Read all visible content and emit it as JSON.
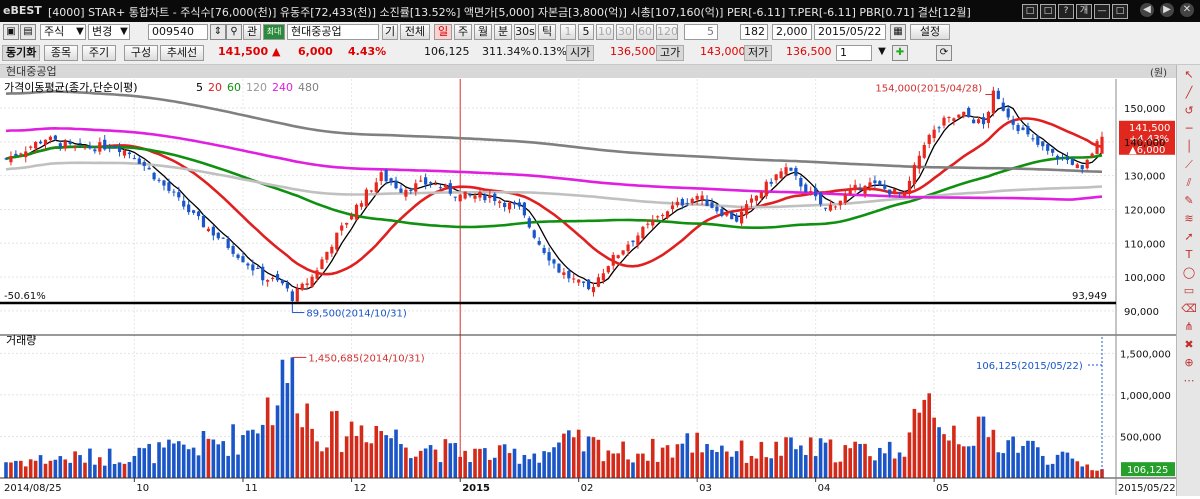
{
  "window": {
    "logo": "eBEST",
    "title": "[4000] STAR+ 통합차트 - 주식수[76,000(천)] 유동주[72,433(천)] 소진률[13.52%] 액면가[5,000] 자본금[3,800(억)] 시총[107,160(억)] PER[-6.11] T.PER[-6.11] PBR[0.71] 결산[12월]",
    "buttons": [
      "□",
      "□",
      "?",
      "개",
      "—",
      "□"
    ],
    "right_buttons": [
      "◀",
      "▶",
      "✕"
    ]
  },
  "toolbar1": {
    "market": "주식",
    "mode": "변경",
    "code": "009540",
    "relation": "관",
    "badge": "최대",
    "name": "현대중공업",
    "gi": "기",
    "jeonche": "전체",
    "periods": [
      "일",
      "주",
      "월",
      "분",
      "30s",
      "틱"
    ],
    "period_selected": "일",
    "numbers": [
      "1",
      "5",
      "10",
      "30",
      "60",
      "120"
    ],
    "number_sel": "5",
    "count": "182",
    "zoom": "2,000",
    "date": "2015/05/22",
    "settings": "설정"
  },
  "toolbar2": {
    "sync": "동기화",
    "buttons": [
      "종목",
      "주기",
      "구성",
      "추세선"
    ],
    "price": "141,500",
    "change": "6,000",
    "change_pct": "4.43%",
    "volume": "106,125",
    "vol_ratio": "311.34%",
    "turnover": "0.13%",
    "open_label": "시가",
    "open": "136,500",
    "high_label": "고가",
    "high": "143,000",
    "low_label": "저가",
    "low": "136,500",
    "sel": "1"
  },
  "chart": {
    "stock_name": "현대중공업",
    "unit": "(원)",
    "ma_label": "가격이동평균(종가,단순이평)",
    "ma_periods": [
      "5",
      "20",
      "60",
      "120",
      "240",
      "480"
    ],
    "ma_colors": [
      "#000000",
      "#e02020",
      "#109010",
      "#c0c0c0",
      "#e020e0",
      "#808080"
    ],
    "high_annotation": "154,000(2015/04/28)",
    "low_annotation": "89,500(2014/10/31)",
    "left_pct": "-50.61%",
    "right_value": "93,949",
    "price_tag": [
      "141,500",
      "+4.43%",
      "▲6,000"
    ],
    "volume_label": "거래량",
    "vol_max_annotation": "1,450,685(2014/10/31)",
    "vol_last_annotation": "106,125(2015/05/22)",
    "vol_tag": "106,125",
    "x_start": "2014/08/25",
    "x_end": "2015/05/22",
    "months": [
      "10",
      "11",
      "12",
      "2015",
      "02",
      "03",
      "04",
      "05"
    ]
  },
  "chart_data": {
    "type": "candlestick",
    "price_axis": {
      "ticks": [
        "150,000",
        "140,000",
        "130,000",
        "120,000",
        "110,000",
        "100,000",
        "90,000"
      ],
      "range": [
        87000,
        158000
      ]
    },
    "volume_axis": {
      "ticks": [
        "1,500,000",
        "1,000,000",
        "500,000"
      ],
      "range": [
        0,
        1600000
      ]
    },
    "close_keypoints": [
      [
        0,
        135000
      ],
      [
        8,
        141000
      ],
      [
        14,
        138000
      ],
      [
        22,
        139000
      ],
      [
        26,
        136000
      ],
      [
        32,
        127000
      ],
      [
        38,
        118000
      ],
      [
        46,
        108000
      ],
      [
        52,
        100000
      ],
      [
        56,
        98000
      ],
      [
        58,
        94000
      ],
      [
        62,
        100000
      ],
      [
        66,
        110000
      ],
      [
        72,
        123000
      ],
      [
        76,
        130000
      ],
      [
        80,
        126000
      ],
      [
        86,
        128000
      ],
      [
        92,
        124000
      ],
      [
        98,
        124000
      ],
      [
        104,
        120000
      ],
      [
        108,
        110000
      ],
      [
        112,
        102000
      ],
      [
        116,
        98000
      ],
      [
        118,
        96000
      ],
      [
        122,
        104000
      ],
      [
        126,
        110000
      ],
      [
        130,
        115000
      ],
      [
        134,
        120000
      ],
      [
        140,
        124000
      ],
      [
        144,
        120000
      ],
      [
        148,
        117000
      ],
      [
        152,
        124000
      ],
      [
        156,
        130000
      ],
      [
        158,
        132000
      ],
      [
        162,
        126000
      ],
      [
        166,
        120000
      ],
      [
        170,
        124000
      ],
      [
        174,
        128000
      ],
      [
        178,
        126000
      ],
      [
        182,
        124000
      ],
      [
        186,
        140000
      ],
      [
        190,
        146000
      ],
      [
        194,
        148000
      ],
      [
        198,
        145000
      ],
      [
        200,
        154000
      ],
      [
        204,
        146000
      ],
      [
        208,
        140000
      ],
      [
        212,
        136000
      ],
      [
        216,
        134000
      ],
      [
        218,
        131000
      ],
      [
        220,
        137000
      ],
      [
        222,
        141500
      ]
    ],
    "volume_keypoints": [
      [
        0,
        200000
      ],
      [
        20,
        260000
      ],
      [
        34,
        330000
      ],
      [
        40,
        400000
      ],
      [
        48,
        500000
      ],
      [
        56,
        1100000
      ],
      [
        58,
        1450685
      ],
      [
        62,
        600000
      ],
      [
        68,
        550000
      ],
      [
        74,
        650000
      ],
      [
        80,
        450000
      ],
      [
        90,
        320000
      ],
      [
        100,
        280000
      ],
      [
        108,
        300000
      ],
      [
        114,
        420000
      ],
      [
        120,
        380000
      ],
      [
        126,
        300000
      ],
      [
        134,
        350000
      ],
      [
        140,
        450000
      ],
      [
        150,
        300000
      ],
      [
        160,
        360000
      ],
      [
        170,
        330000
      ],
      [
        180,
        340000
      ],
      [
        186,
        700000
      ],
      [
        188,
        1080000
      ],
      [
        190,
        600000
      ],
      [
        198,
        520000
      ],
      [
        205,
        420000
      ],
      [
        212,
        260000
      ],
      [
        222,
        106125
      ]
    ],
    "annotations": {
      "high": [
        200,
        154000
      ],
      "low": [
        58,
        89500
      ]
    }
  }
}
